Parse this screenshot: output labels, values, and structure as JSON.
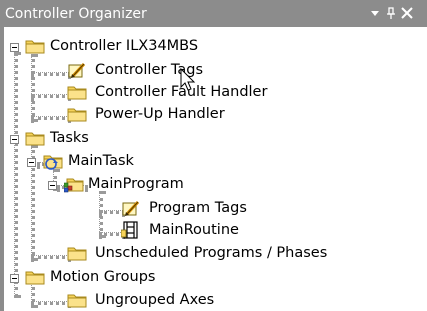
{
  "panel": {
    "title": "Controller Organizer",
    "buttons": [
      "dropdown-arrow-icon",
      "pin-icon",
      "close-icon"
    ]
  },
  "tree": {
    "controller": {
      "label": "Controller ILX34MBS",
      "expanded": true,
      "icon": "folder-icon"
    },
    "controller_tags": {
      "label": "Controller Tags",
      "icon": "tag-edit-icon"
    },
    "fault_handler": {
      "label": "Controller Fault Handler",
      "icon": "folder-icon"
    },
    "powerup_handler": {
      "label": "Power-Up Handler",
      "icon": "folder-icon"
    },
    "tasks": {
      "label": "Tasks",
      "expanded": true,
      "icon": "folder-icon"
    },
    "main_task": {
      "label": "MainTask",
      "expanded": true,
      "icon": "task-folder-icon"
    },
    "main_program": {
      "label": "MainProgram",
      "expanded": true,
      "icon": "program-folder-icon"
    },
    "program_tags": {
      "label": "Program Tags",
      "icon": "tag-edit-icon"
    },
    "main_routine": {
      "label": "MainRoutine",
      "icon": "ladder-routine-icon"
    },
    "unscheduled": {
      "label": "Unscheduled Programs / Phases",
      "icon": "folder-icon"
    },
    "motion_groups": {
      "label": "Motion Groups",
      "expanded": true,
      "icon": "folder-icon"
    },
    "ungrouped_axes": {
      "label": "Ungrouped Axes",
      "icon": "folder-icon"
    }
  },
  "colors": {
    "titlebar": "#8c8c8c",
    "folder_fill": "#f6d35a",
    "folder_edge": "#a88a1e",
    "tree_line": "#9a9a9a"
  }
}
